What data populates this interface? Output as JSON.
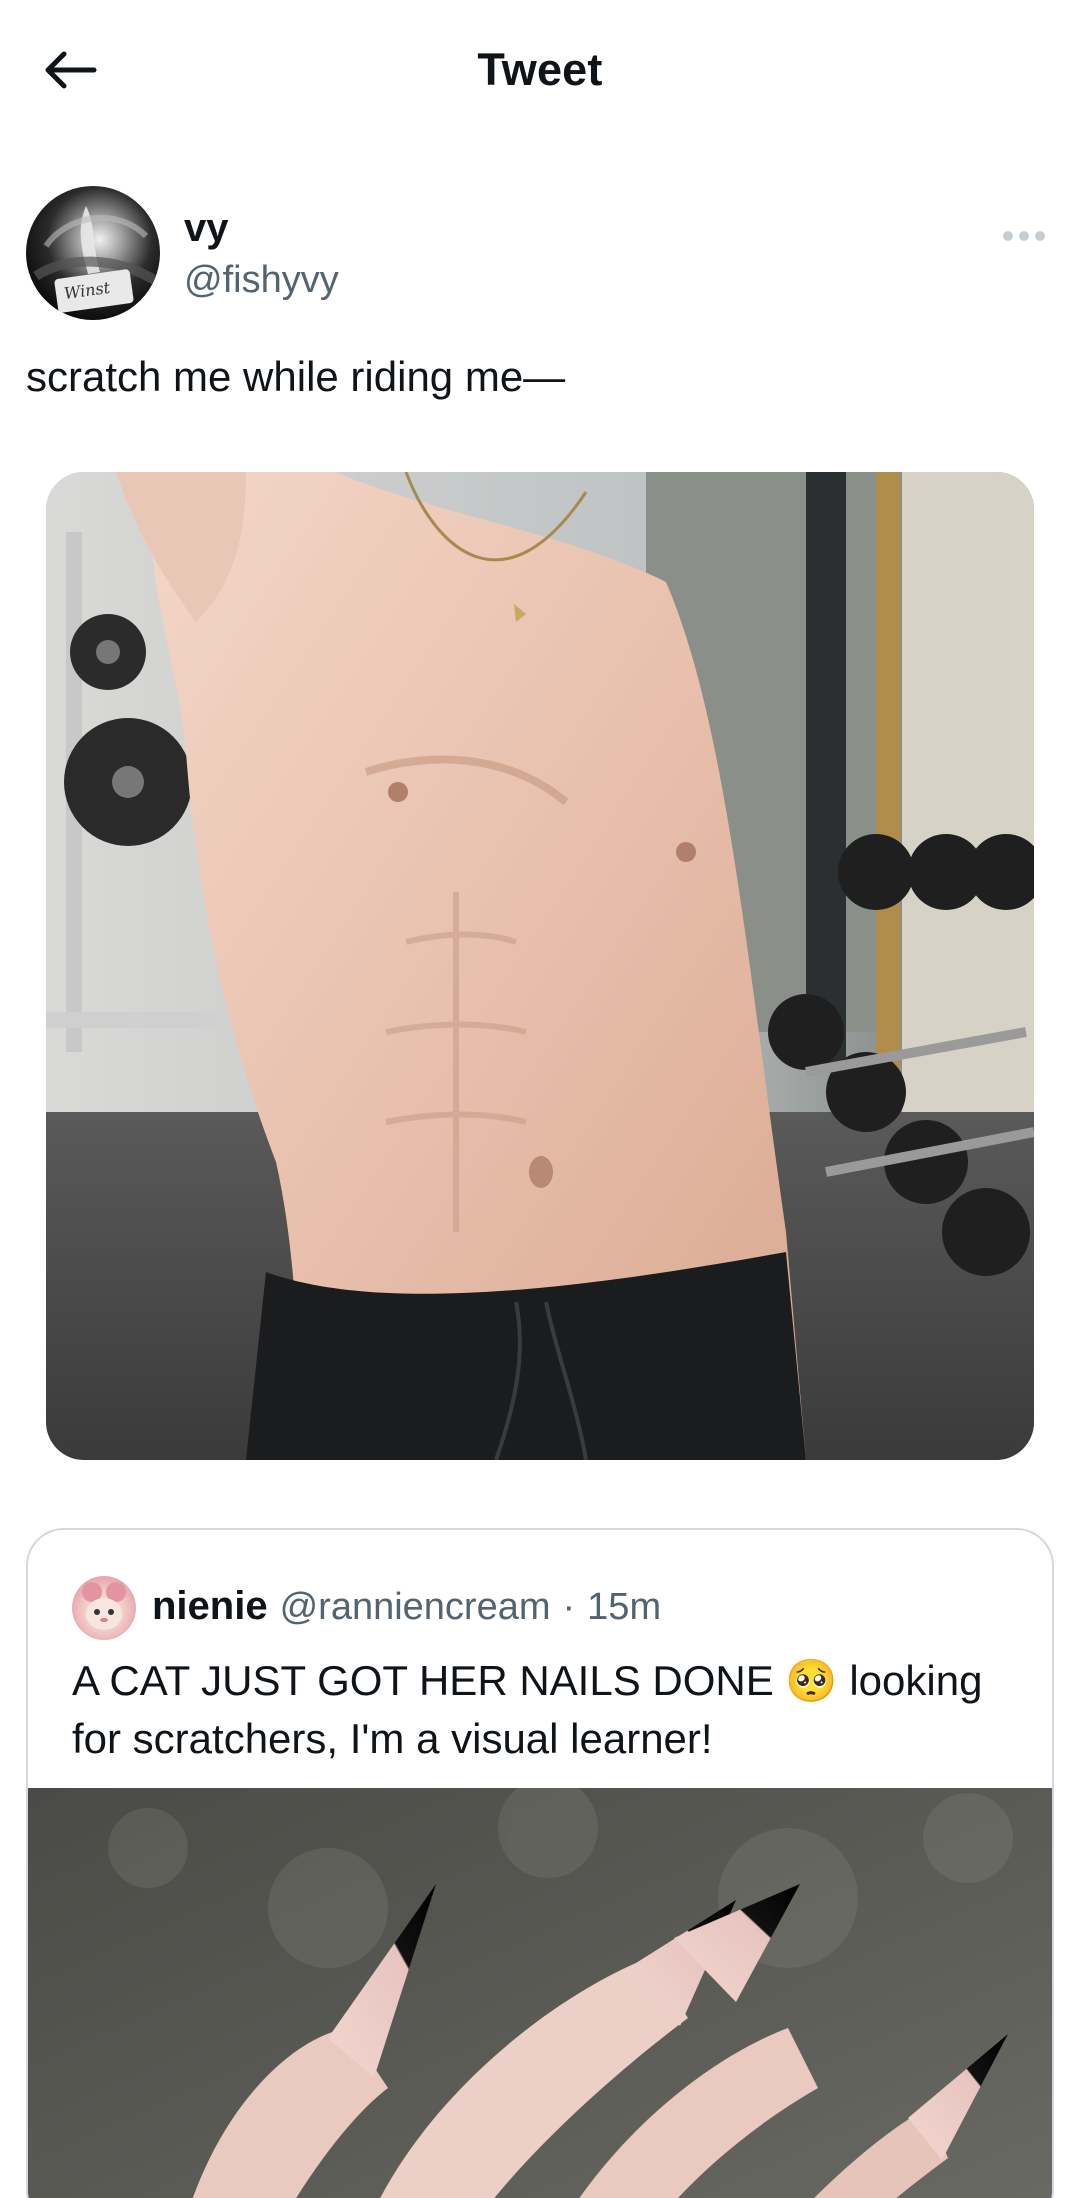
{
  "header": {
    "title": "Tweet",
    "back_icon": "arrow-left-icon"
  },
  "tweet": {
    "author_name": "vy",
    "author_handle": "@fishyvy",
    "avatar_card_text": "Winst",
    "more_icon": "more-horizontal-icon",
    "text": "scratch me while riding me—",
    "media_description_icon": "photo"
  },
  "quote": {
    "author_name": "nienie",
    "author_handle": "@ranniencream",
    "separator": "·",
    "time": "15m",
    "text": "A CAT JUST GOT HER NAILS DONE 🥺 looking for scratchers, I'm a visual learner!"
  },
  "colors": {
    "text_primary": "#0f1419",
    "text_secondary": "#536471",
    "border": "#cfd9de",
    "background": "#ffffff"
  }
}
